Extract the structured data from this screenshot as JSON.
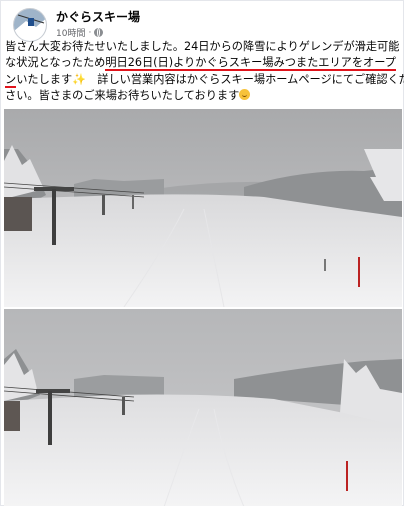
{
  "post": {
    "author": "かぐらスキー場",
    "time": "10時間",
    "privacy_icon": "globe-icon",
    "text_lines": [
      "皆さん大変お待たせいたしました。24日からの降雪によりゲレンデが滑走可能",
      "な状況となったため",
      "明日26日(日)よりかぐらスキー場みつまたエリアをオープ",
      "ン",
      "いたします",
      "✨",
      "　詳しい営業内容はかぐらスキー場ホームページにてご確認くだ",
      "さい。皆さまのご来場お待ちいたしております",
      "smiling-face-emoji"
    ],
    "underline_color": "#e0141c"
  },
  "photos": [
    {
      "subject": "snowy-ski-slope-with-chairlift"
    },
    {
      "subject": "snowy-ski-slope-with-chairlift"
    }
  ]
}
